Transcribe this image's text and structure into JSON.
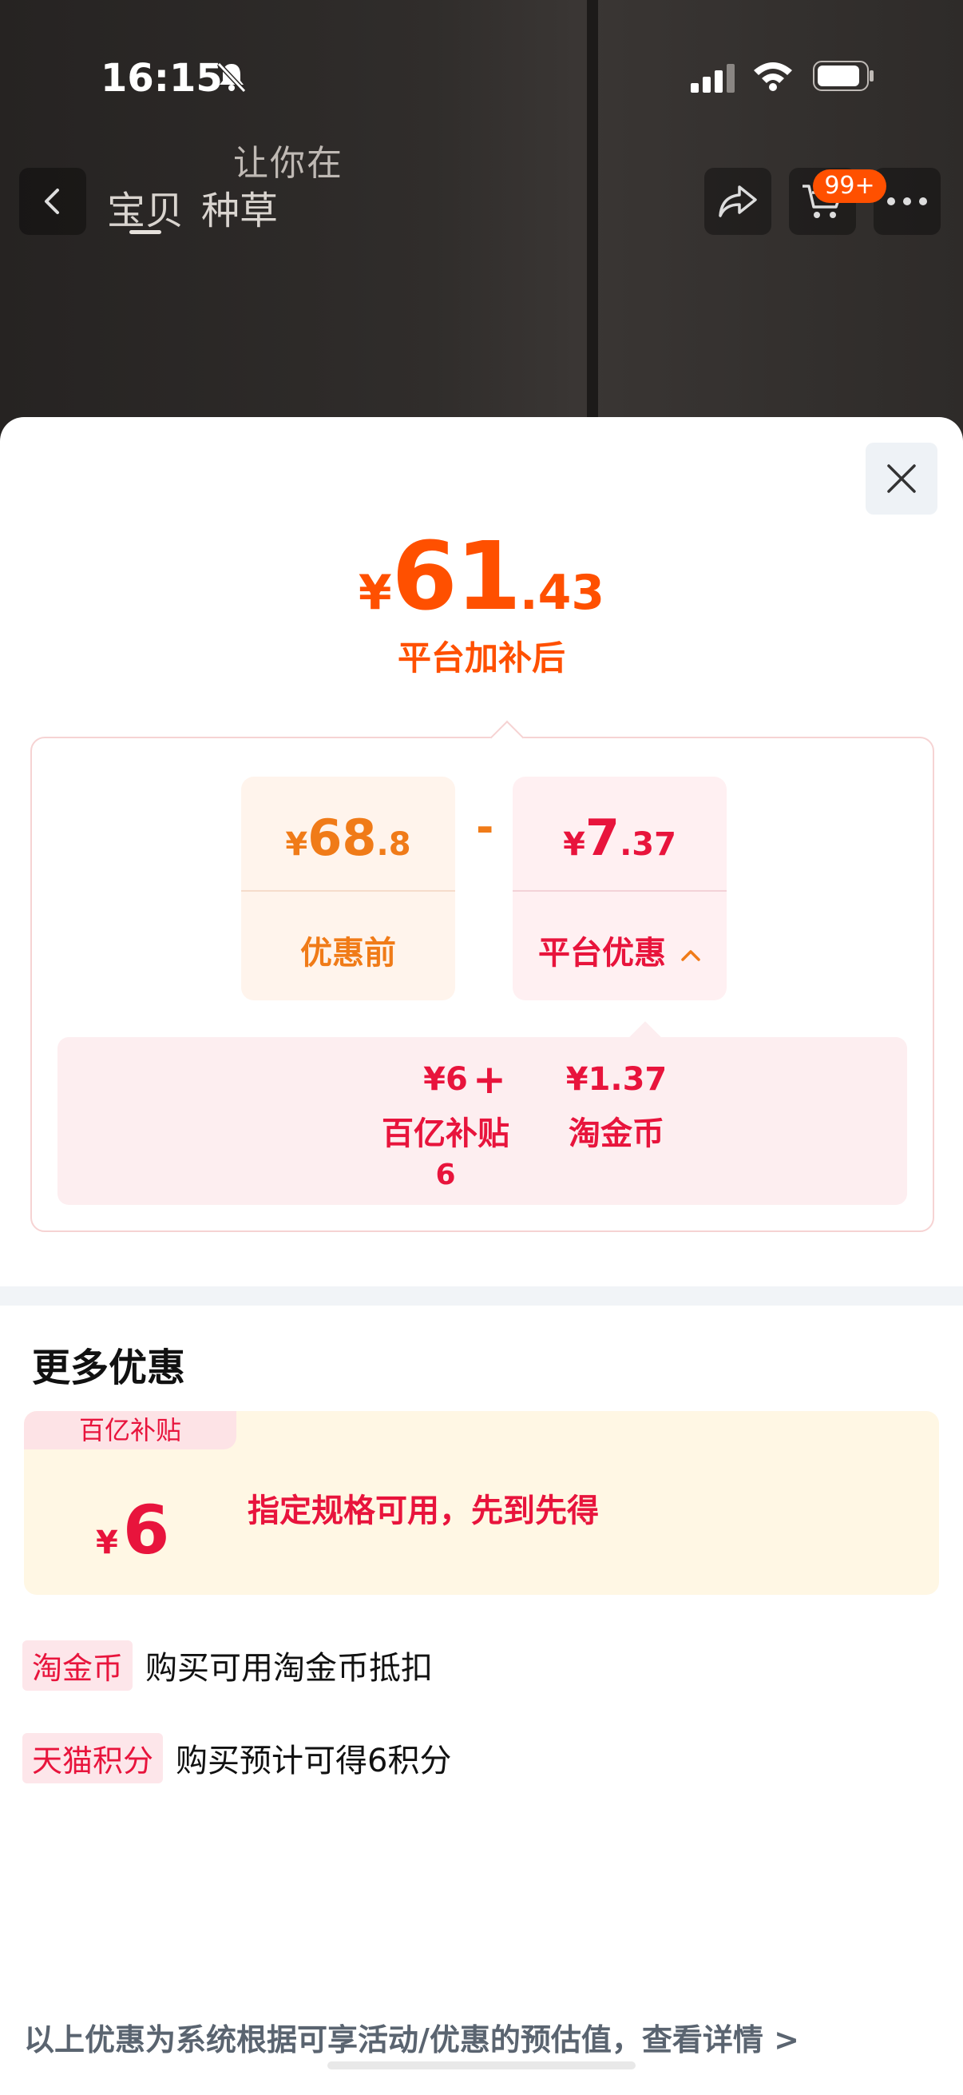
{
  "status_bar": {
    "time": "16:15"
  },
  "background": {
    "overlay_text": "让你在"
  },
  "nav": {
    "tab_baobei": "宝贝",
    "tab_zhongcao": "种草",
    "cart_badge": "99+"
  },
  "sheet": {
    "total_price": {
      "yen": "¥",
      "integer": "61",
      "decimal": ".43"
    },
    "total_caption": "平台加补后",
    "before": {
      "yen": "¥",
      "integer": "68",
      "decimal": ".8",
      "label": "优惠前"
    },
    "operator": "-",
    "platform": {
      "yen": "¥",
      "integer": "7",
      "decimal": ".37",
      "label": "平台优惠"
    },
    "subsidies": [
      {
        "amount": "¥6",
        "name": "百亿补贴",
        "extra": "6"
      },
      {
        "amount": "¥1.37",
        "name": "淘金币",
        "extra": ""
      }
    ],
    "plus": "+",
    "more_title": "更多优惠",
    "coupon": {
      "tag": "百亿补贴",
      "yen": "¥",
      "value": "6",
      "desc": "指定规格可用，先到先得"
    },
    "perks": [
      {
        "tag": "淘金币",
        "text": "购买可用淘金币抵扣"
      },
      {
        "tag": "天猫积分",
        "text": "购买预计可得6积分"
      }
    ],
    "footer_note": "以上优惠为系统根据可享活动/优惠的预估值，查看详情 >"
  },
  "colors": {
    "orange": "#ff5000",
    "red": "#e8143c"
  }
}
